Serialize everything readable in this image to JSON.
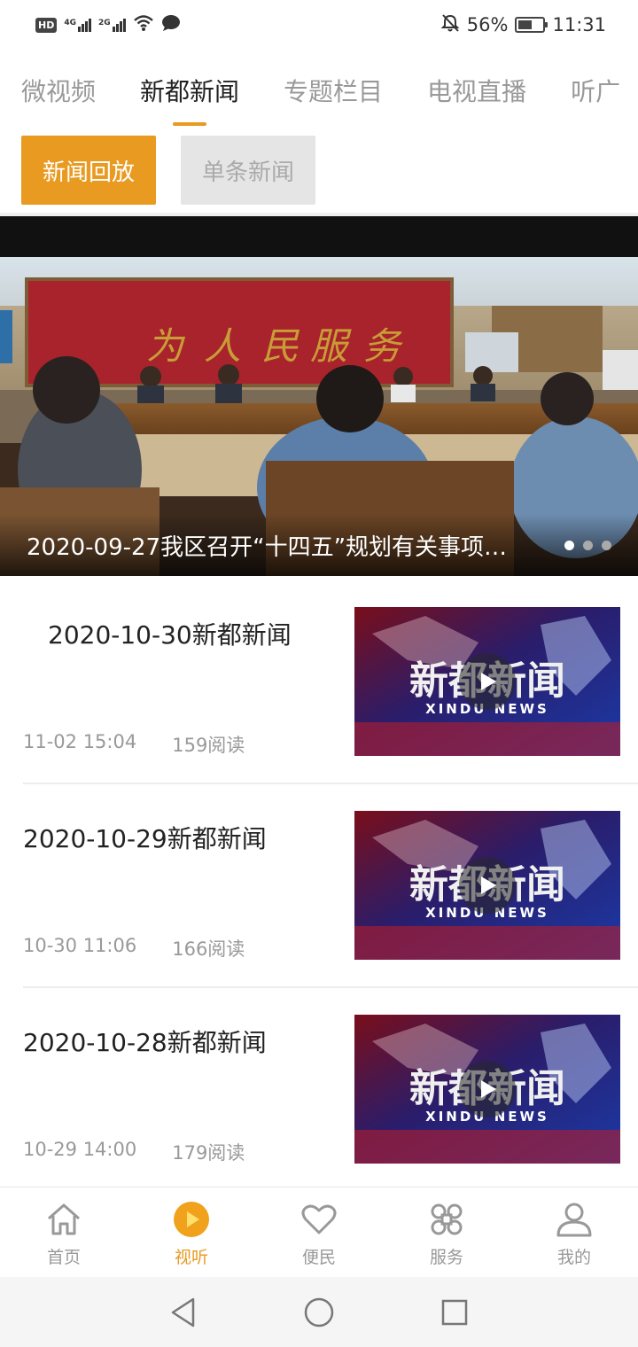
{
  "status_bar": {
    "hd": "HD",
    "net1": "4G",
    "net2": "2G",
    "battery_pct": "56%",
    "battery_level": 0.56,
    "time": "11:31",
    "icons": [
      "hd-icon",
      "signal-4g-icon",
      "signal-2g-icon",
      "wifi-icon",
      "message-icon",
      "mute-icon",
      "battery-icon"
    ]
  },
  "top_tabs": [
    {
      "label": "微视频",
      "active": false
    },
    {
      "label": "新都新闻",
      "active": true
    },
    {
      "label": "专题栏目",
      "active": false
    },
    {
      "label": "电视直播",
      "active": false
    },
    {
      "label": "听广",
      "active": false
    }
  ],
  "sub_tabs": [
    {
      "label": "新闻回放",
      "active": true
    },
    {
      "label": "单条新闻",
      "active": false
    }
  ],
  "banner": {
    "title": "2020-09-27我区召开“十四五”规划有关事项…",
    "slide_count": 3,
    "active_slide": 0,
    "image_lettering": "为人民服务"
  },
  "news": [
    {
      "title": "2020-10-30新都新闻",
      "date": "11-02 15:04",
      "reads": "159阅读",
      "thumb_title": "新都新闻",
      "thumb_sub": "XINDU NEWS"
    },
    {
      "title": "2020-10-29新都新闻",
      "date": "10-30 11:06",
      "reads": "166阅读",
      "thumb_title": "新都新闻",
      "thumb_sub": "XINDU NEWS"
    },
    {
      "title": "2020-10-28新都新闻",
      "date": "10-29 14:00",
      "reads": "179阅读",
      "thumb_title": "新都新闻",
      "thumb_sub": "XINDU NEWS"
    }
  ],
  "bottom_nav": [
    {
      "label": "首页",
      "icon": "home-icon",
      "active": false
    },
    {
      "label": "视听",
      "icon": "play-icon",
      "active": true
    },
    {
      "label": "便民",
      "icon": "heart-icon",
      "active": false
    },
    {
      "label": "服务",
      "icon": "command-icon",
      "active": false
    },
    {
      "label": "我的",
      "icon": "profile-icon",
      "active": false
    }
  ],
  "system_nav": [
    "back-icon",
    "home-circle-icon",
    "recents-icon"
  ],
  "colors": {
    "accent": "#e89a21",
    "inactive_text": "#999999",
    "sub_inactive_bg": "#e5e5e5"
  }
}
